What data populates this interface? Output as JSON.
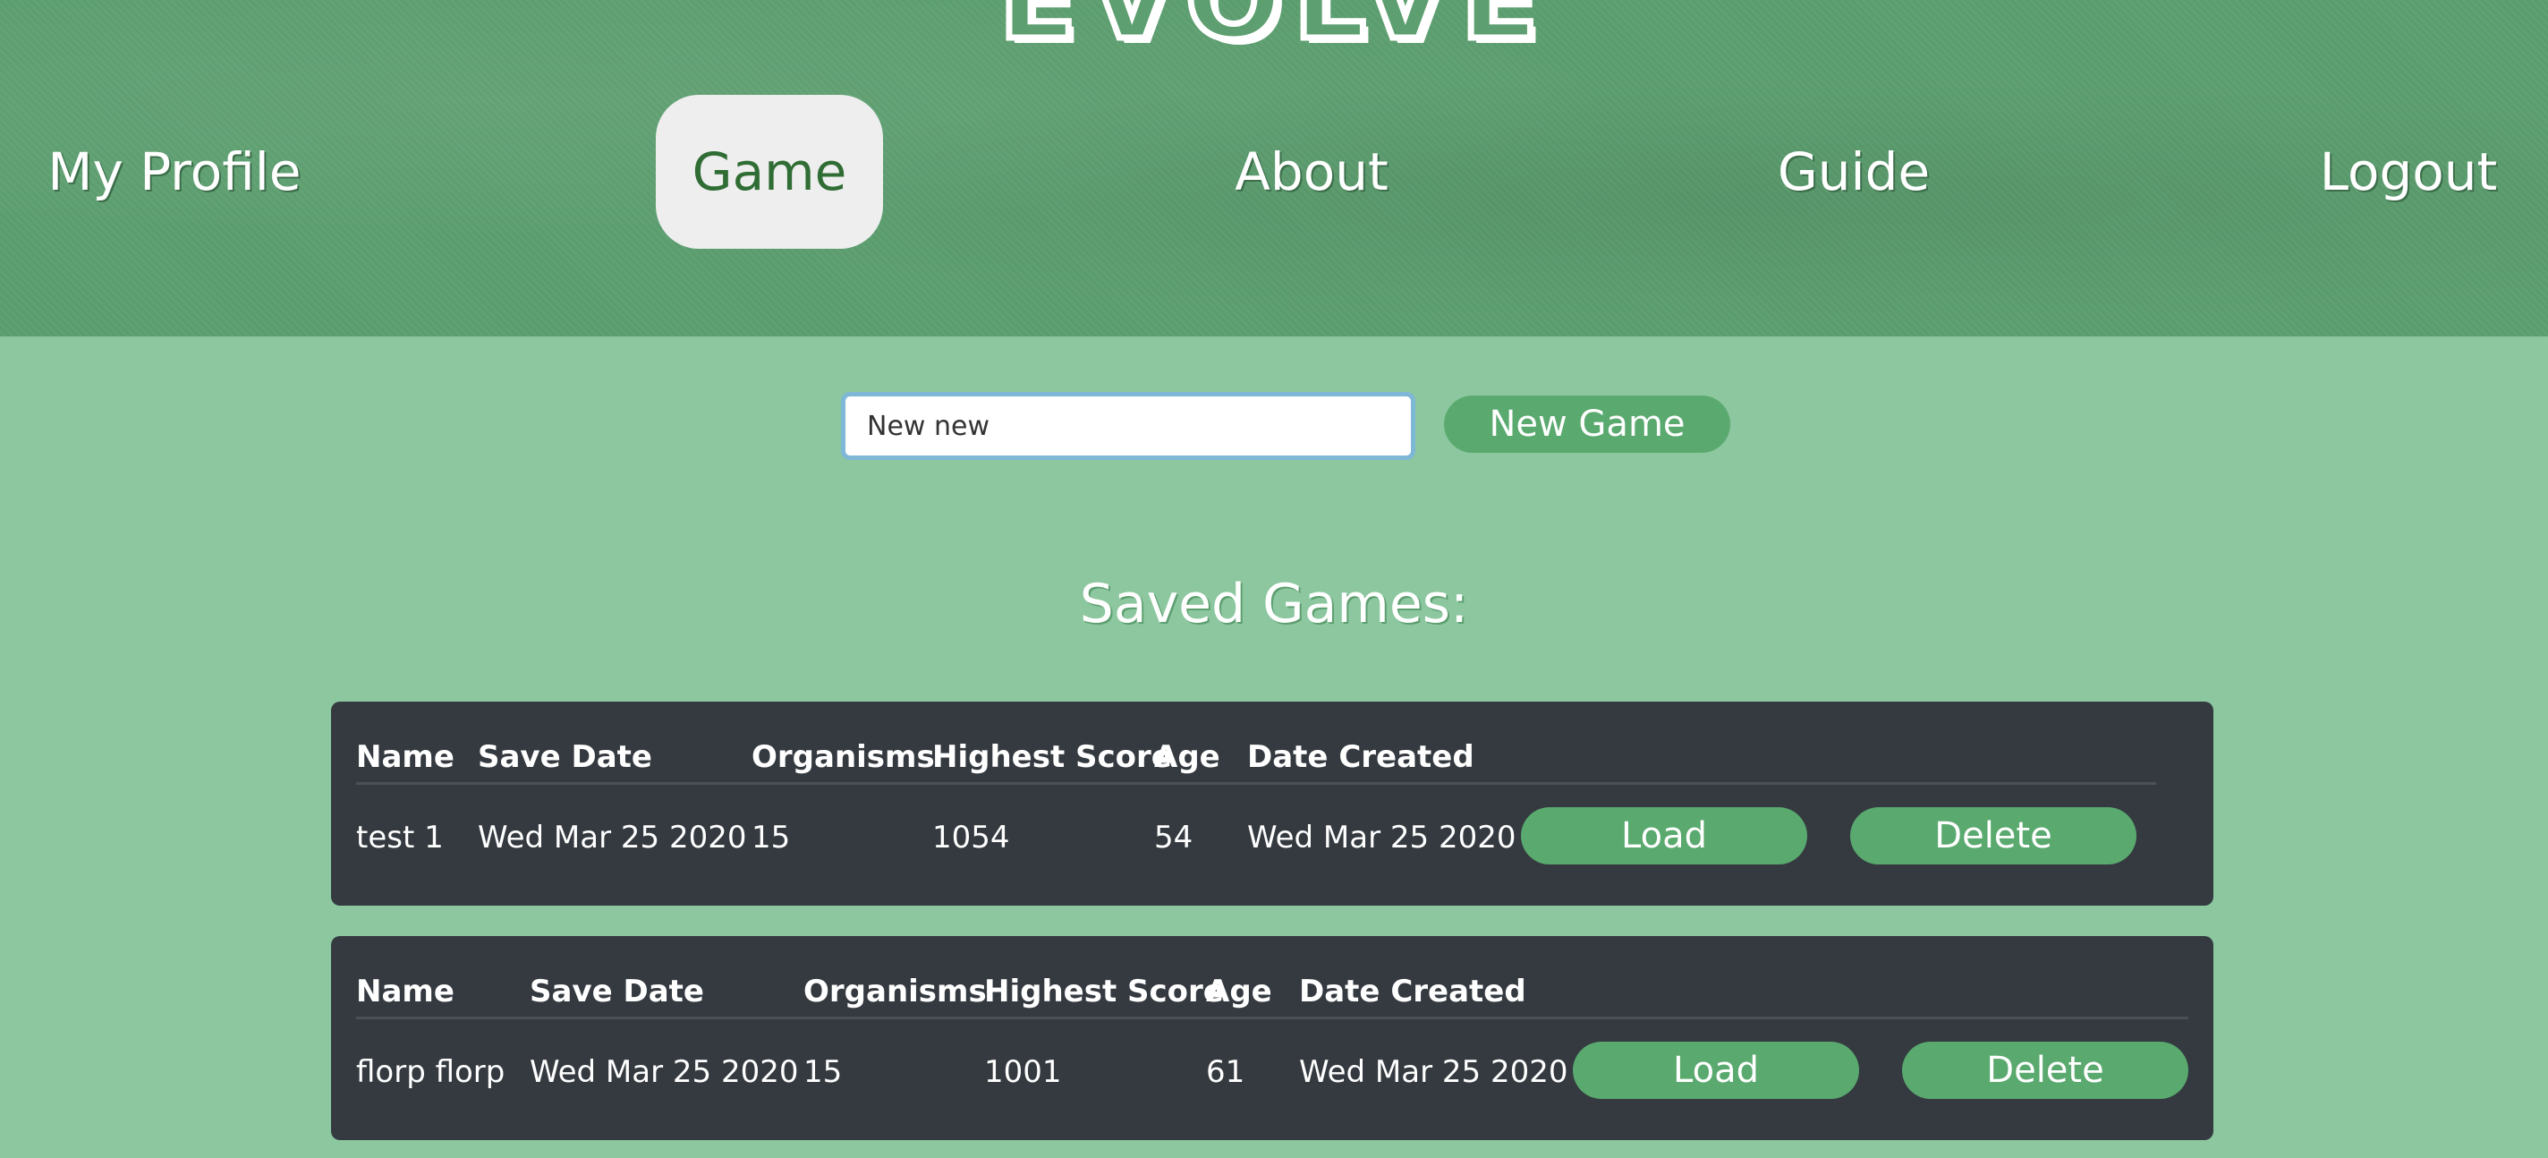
{
  "header": {
    "logo": "EVOLVE",
    "nav": [
      {
        "label": "My Profile"
      },
      {
        "label": "Game"
      },
      {
        "label": "About"
      },
      {
        "label": "Guide"
      },
      {
        "label": "Logout"
      }
    ]
  },
  "new_game": {
    "input_value": "New new",
    "button_label": "New Game"
  },
  "saved_games": {
    "title": "Saved Games:",
    "columns": [
      "Name",
      "Save Date",
      "Organisms",
      "Highest Score",
      "Age",
      "Date Created"
    ],
    "games": [
      {
        "name": "test 1",
        "save_date": "Wed Mar 25 2020",
        "organisms": "15",
        "highest_score": "1054",
        "age": "54",
        "date_created": "Wed Mar 25 2020",
        "load_label": "Load",
        "delete_label": "Delete"
      },
      {
        "name": "florp florp",
        "save_date": "Wed Mar 25 2020",
        "organisms": "15",
        "highest_score": "1001",
        "age": "61",
        "date_created": "Wed Mar 25 2020",
        "load_label": "Load",
        "delete_label": "Delete"
      }
    ]
  },
  "colors": {
    "background": "#8cc79f",
    "header": "#5d9f70",
    "button": "#5aa96f",
    "card": "#343a40"
  }
}
